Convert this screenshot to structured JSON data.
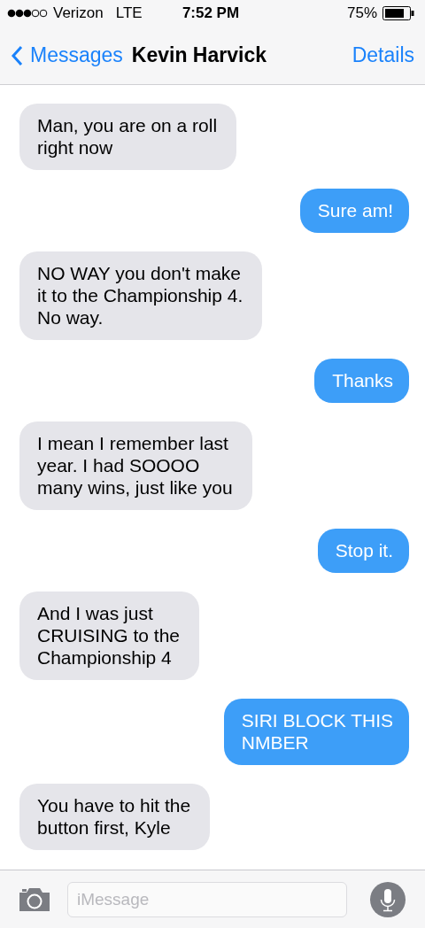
{
  "status_bar": {
    "carrier": "Verizon",
    "network": "LTE",
    "time": "7:52 PM",
    "battery": "75%"
  },
  "nav_bar": {
    "back": "Messages",
    "title": "Kevin Harvick",
    "action": "Details"
  },
  "messages": [
    {
      "kind": "received",
      "text": "Man, you are on a roll\nright now"
    },
    {
      "kind": "sent",
      "text": "Sure am!"
    },
    {
      "kind": "received",
      "text": "NO WAY you don't make\nit to the Championship 4.\nNo way."
    },
    {
      "kind": "sent",
      "text": "Thanks"
    },
    {
      "kind": "received",
      "text": "I mean I remember last\nyear. I had SOOOO\nmany wins, just like you"
    },
    {
      "kind": "sent",
      "text": "Stop it."
    },
    {
      "kind": "received",
      "text": "And I was just\nCRUISING to the\nChampionship 4"
    },
    {
      "kind": "sent",
      "text": "SIRI BLOCK THIS\nNMBER"
    },
    {
      "kind": "received",
      "text": "You have to hit the\nbutton first, Kyle"
    }
  ],
  "compose": {
    "placeholder": "iMessage"
  }
}
